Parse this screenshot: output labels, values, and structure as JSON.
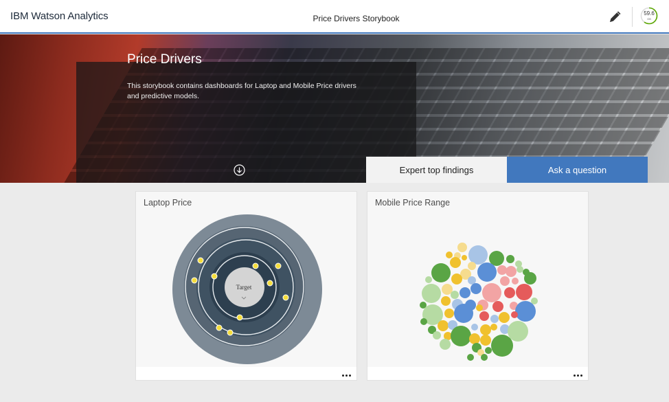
{
  "app": {
    "brand": "IBM Watson Analytics",
    "title": "Price Drivers Storybook"
  },
  "toolbar": {
    "edit_icon": "pencil-icon",
    "usage_value": "59.6",
    "usage_unit": "GB",
    "usage_fraction": 0.6,
    "usage_color": "#5aa700"
  },
  "hero": {
    "title": "Price Drivers",
    "description": "This storybook contains dashboards for Laptop and Mobile Price drivers and predictive models.",
    "scroll_icon": "arrow-down-circle-icon"
  },
  "tabs": [
    {
      "label": "Expert top findings",
      "selected": true
    },
    {
      "label": "Ask a question",
      "selected": false
    }
  ],
  "cards": [
    {
      "title": "Laptop Price",
      "viz": "spiral",
      "target_label": "Target",
      "menu_icon": "more-horizontal-icon"
    },
    {
      "title": "Mobile Price Range",
      "viz": "bubble-cluster",
      "menu_icon": "more-horizontal-icon"
    }
  ],
  "colors": {
    "accent": "#4178be",
    "green": "#5aa545",
    "blue": "#5b8fd6",
    "red": "#e55b5b",
    "yellow": "#f0c12e",
    "light_blue": "#a8c4e6",
    "pink": "#f2a4a4",
    "light_green": "#b6dba3",
    "light_yellow": "#f6dc8e"
  }
}
